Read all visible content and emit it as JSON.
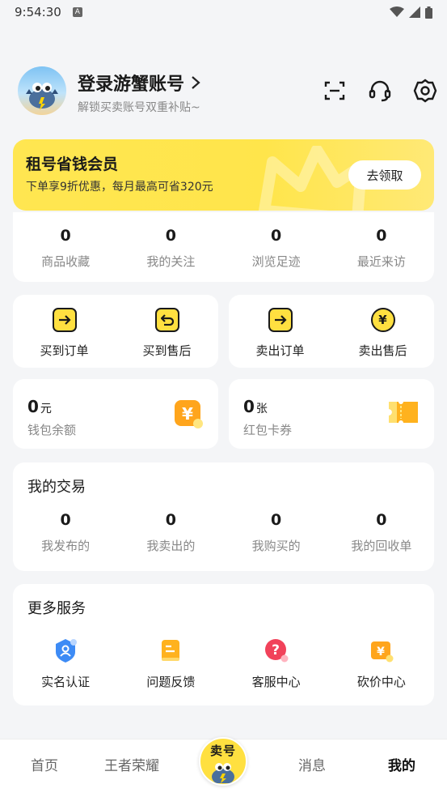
{
  "status_bar": {
    "time": "9:54:30"
  },
  "header": {
    "login_title": "登录游蟹账号",
    "login_subtitle": "解锁买卖账号双重补贴~"
  },
  "member_banner": {
    "title": "租号省钱会员",
    "description": "下单享9折优惠，每月最高可省320元",
    "button_label": "去领取"
  },
  "stats": [
    {
      "value": "0",
      "label": "商品收藏"
    },
    {
      "value": "0",
      "label": "我的关注"
    },
    {
      "value": "0",
      "label": "浏览足迹"
    },
    {
      "value": "0",
      "label": "最近来访"
    }
  ],
  "buy_orders": [
    {
      "label": "买到订单"
    },
    {
      "label": "买到售后"
    }
  ],
  "sell_orders": [
    {
      "label": "卖出订单"
    },
    {
      "label": "卖出售后"
    }
  ],
  "wallet": {
    "value": "0",
    "unit": "元",
    "label": "钱包余额"
  },
  "coupons": {
    "value": "0",
    "unit": "张",
    "label": "红包卡券"
  },
  "trade": {
    "title": "我的交易",
    "items": [
      {
        "value": "0",
        "label": "我发布的"
      },
      {
        "value": "0",
        "label": "我卖出的"
      },
      {
        "value": "0",
        "label": "我购买的"
      },
      {
        "value": "0",
        "label": "我的回收单"
      }
    ]
  },
  "services": {
    "title": "更多服务",
    "items": [
      {
        "label": "实名认证",
        "icon": "shield-user-icon"
      },
      {
        "label": "问题反馈",
        "icon": "feedback-doc-icon"
      },
      {
        "label": "客服中心",
        "icon": "question-icon"
      },
      {
        "label": "砍价中心",
        "icon": "yen-tag-icon"
      }
    ]
  },
  "tabbar": {
    "home": "首页",
    "game": "王者荣耀",
    "sell": "卖号",
    "messages": "消息",
    "mine": "我的"
  },
  "colors": {
    "accent": "#ffe040",
    "background": "#f4f5f7"
  }
}
